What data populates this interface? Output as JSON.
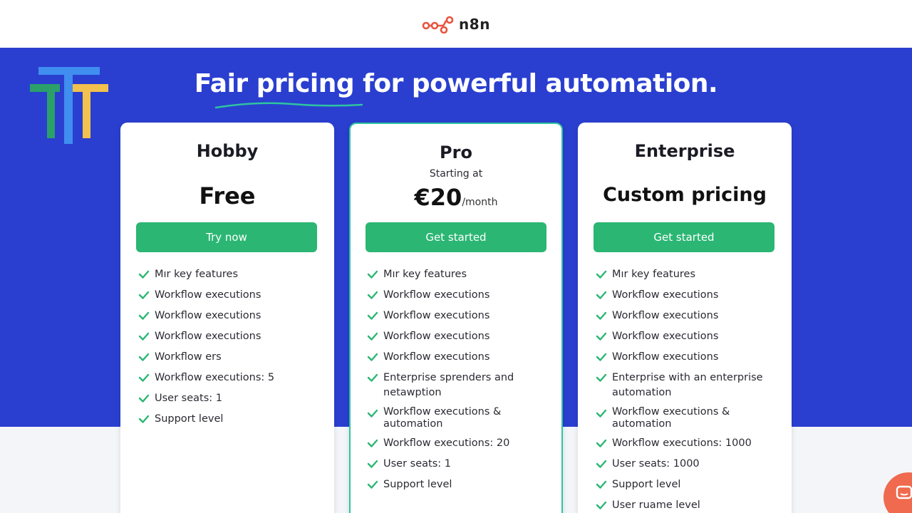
{
  "header": {
    "logo_text": "n8n"
  },
  "hero": {
    "title": "Fair pricing for powerful automation."
  },
  "plans": [
    {
      "name": "Hobby",
      "price": "Free",
      "cta": "Try now",
      "features": [
        "Mır key features",
        "Workflow executions",
        "Workflow executions",
        "Workflow executions",
        "Workflow ers",
        "Workflow executions: 5",
        "User seats: 1",
        "Support level"
      ]
    },
    {
      "name": "Pro",
      "subtitle": "Starting at",
      "price": "€20",
      "price_unit": "/month",
      "cta": "Get started",
      "features": [
        "Mır key features",
        "Workflow executions",
        "Workflow executions",
        "Workflow executions",
        "Workflow executions",
        "Enterprise sprenders and netawption",
        "Workflow executions & automation",
        "Workflow executions: 20",
        "User seats: 1",
        "Support level"
      ]
    },
    {
      "name": "Enterprise",
      "price": "Custom pricing",
      "cta": "Get started",
      "features": [
        "Mır key features",
        "Workflow executions",
        "Workflow executions",
        "Workflow executions",
        "Workflow executions",
        "Enterprise with an enterprise automation",
        "Workflow executions & automation",
        "Workflow executions: 1000",
        "User seats: 1000",
        "Support level",
        "User ruame level"
      ]
    }
  ],
  "colors": {
    "hero_bg": "#2a3fd0",
    "cta_bg": "#2bb673",
    "check": "#2bb673",
    "pro_border": "#2ec4a0",
    "accent_teal": "#2ec4a0",
    "chat_button": "#ef6a4e"
  },
  "icons": {
    "logo": "n8n-nodes-icon",
    "brand_mark": "tt-brand-icon",
    "check": "check-icon",
    "chat": "chat-icon"
  }
}
